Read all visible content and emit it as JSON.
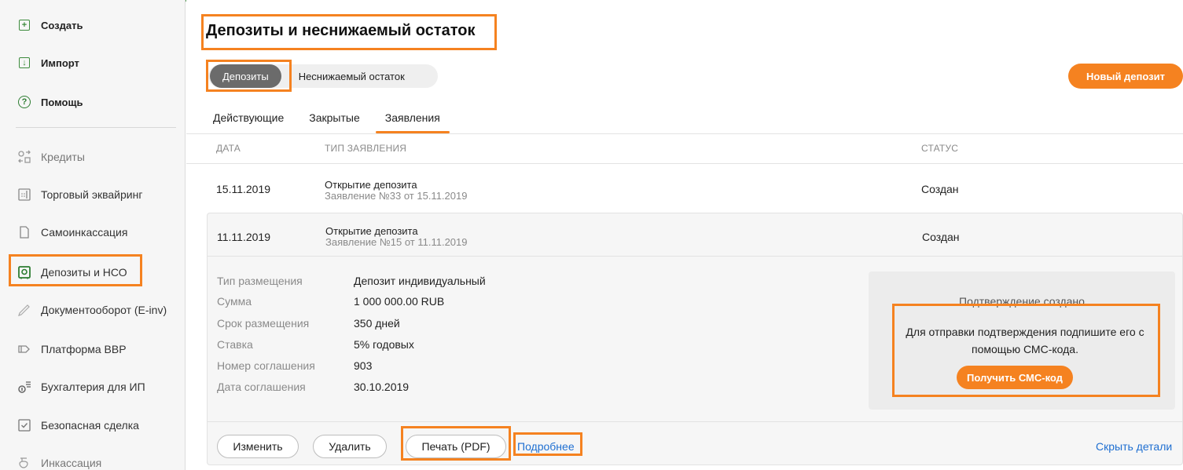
{
  "sidebar": {
    "top_items": [
      {
        "label": "Создать",
        "icon": "plus-doc-icon"
      },
      {
        "label": "Импорт",
        "icon": "import-doc-icon"
      },
      {
        "label": "Помощь",
        "icon": "help-icon"
      }
    ],
    "nav_items": [
      {
        "label": "Кредиты",
        "icon": "credit-icon"
      },
      {
        "label": "Торговый эквайринг",
        "icon": "terminal-icon"
      },
      {
        "label": "Самоинкассация",
        "icon": "document-icon"
      },
      {
        "label": "Депозиты и НСО",
        "icon": "safe-icon"
      },
      {
        "label": "Документооборот (E-inv)",
        "icon": "pen-icon"
      },
      {
        "label": "Платформа ВВР",
        "icon": "tag-icon"
      },
      {
        "label": "Бухгалтерия для ИП",
        "icon": "accounting-icon"
      },
      {
        "label": "Безопасная сделка",
        "icon": "check-doc-icon"
      },
      {
        "label": "Инкассация",
        "icon": "bag-icon"
      }
    ]
  },
  "main": {
    "title": "Депозиты и неснижаемый остаток",
    "segments": [
      "Депозиты",
      "Неснижаемый остаток"
    ],
    "new_deposit_label": "Новый депозит",
    "tabs": [
      "Действующие",
      "Закрытые",
      "Заявления"
    ],
    "table": {
      "headers": {
        "date": "ДАТА",
        "type": "ТИП ЗАЯВЛЕНИЯ",
        "status": "СТАТУС"
      },
      "rows": [
        {
          "date": "15.11.2019",
          "type": "Открытие депозита",
          "sub": "Заявление №33 от 15.11.2019",
          "status": "Создан"
        },
        {
          "date": "11.11.2019",
          "type": "Открытие депозита",
          "sub": "Заявление №15 от 11.11.2019",
          "status": "Создан"
        }
      ]
    },
    "details": [
      {
        "label": "Тип размещения",
        "value": "Депозит индивидуальный"
      },
      {
        "label": "Сумма",
        "value": "1 000 000.00 RUB"
      },
      {
        "label": "Срок размещения",
        "value": "350 дней"
      },
      {
        "label": "Ставка",
        "value": "5% годовых"
      },
      {
        "label": "Номер соглашения",
        "value": "903"
      },
      {
        "label": "Дата соглашения",
        "value": "30.10.2019"
      }
    ],
    "confirm": {
      "title": "Подтверждение создано",
      "text": "Для отправки подтверждения подпишите его с помощью СМС-кода.",
      "button": "Получить СМС-код"
    },
    "actions": {
      "edit": "Изменить",
      "delete": "Удалить",
      "print": "Печать (PDF)",
      "more": "Подробнее",
      "hide": "Скрыть детали"
    }
  },
  "colors": {
    "accent": "#f58220",
    "highlight": "#f58220",
    "link": "#1f6fd1",
    "green": "#3d8b3d"
  }
}
